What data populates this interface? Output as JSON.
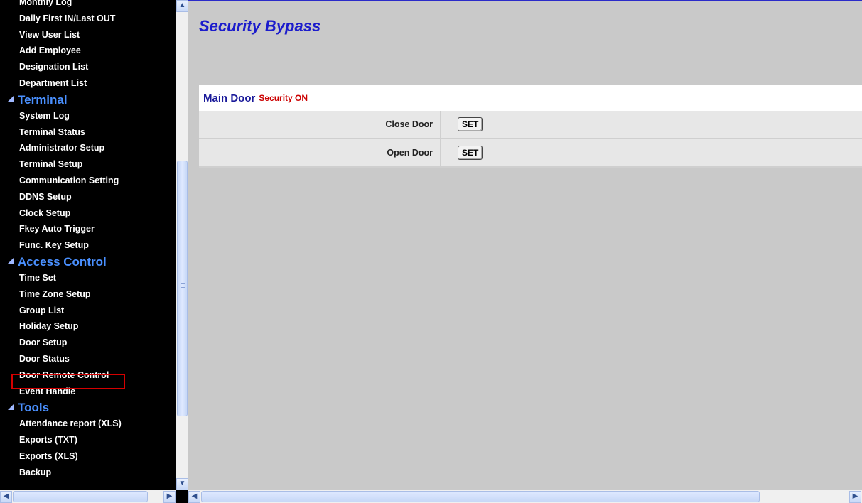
{
  "sidebar": {
    "items": [
      {
        "type": "item",
        "label": "Monthly Log"
      },
      {
        "type": "item",
        "label": "Daily First IN/Last OUT"
      },
      {
        "type": "item",
        "label": "View User List"
      },
      {
        "type": "item",
        "label": "Add Employee"
      },
      {
        "type": "item",
        "label": "Designation List"
      },
      {
        "type": "item",
        "label": "Department List"
      },
      {
        "type": "section",
        "label": "Terminal"
      },
      {
        "type": "item",
        "label": "System Log"
      },
      {
        "type": "item",
        "label": "Terminal Status"
      },
      {
        "type": "item",
        "label": "Administrator Setup"
      },
      {
        "type": "item",
        "label": "Terminal Setup"
      },
      {
        "type": "item",
        "label": "Communication Setting"
      },
      {
        "type": "item",
        "label": "DDNS Setup"
      },
      {
        "type": "item",
        "label": "Clock Setup"
      },
      {
        "type": "item",
        "label": "Fkey Auto Trigger"
      },
      {
        "type": "item",
        "label": "Func. Key Setup"
      },
      {
        "type": "section",
        "label": "Access Control"
      },
      {
        "type": "item",
        "label": "Time Set"
      },
      {
        "type": "item",
        "label": "Time Zone Setup"
      },
      {
        "type": "item",
        "label": "Group List"
      },
      {
        "type": "item",
        "label": "Holiday Setup"
      },
      {
        "type": "item",
        "label": "Door Setup"
      },
      {
        "type": "item",
        "label": "Door Status"
      },
      {
        "type": "item",
        "label": "Door Remote Control",
        "highlighted": true
      },
      {
        "type": "item",
        "label": "Event Handle"
      },
      {
        "type": "section",
        "label": "Tools"
      },
      {
        "type": "item",
        "label": "Attendance report (XLS)"
      },
      {
        "type": "item",
        "label": "Exports (TXT)"
      },
      {
        "type": "item",
        "label": "Exports (XLS)"
      },
      {
        "type": "item",
        "label": "Backup"
      }
    ]
  },
  "main": {
    "title": "Security Bypass",
    "door": {
      "name": "Main Door",
      "status": "Security ON",
      "actions": [
        {
          "label": "Close Door",
          "button": "SET"
        },
        {
          "label": "Open Door",
          "button": "SET"
        }
      ]
    }
  },
  "colors": {
    "title": "#1c1ccc",
    "section": "#4a90ff",
    "status_on": "#cc0000",
    "highlight_border": "#d40000"
  }
}
